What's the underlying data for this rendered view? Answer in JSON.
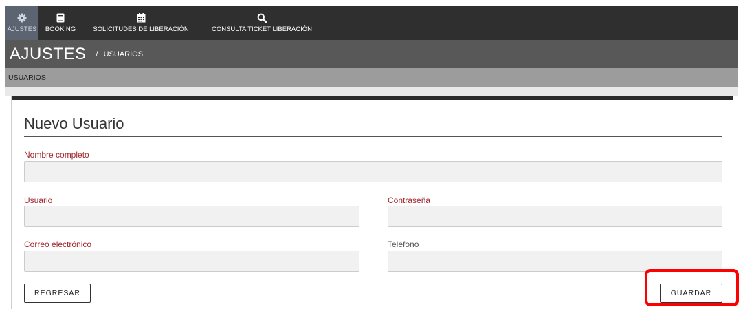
{
  "nav": {
    "items": [
      {
        "label": "AJUSTES",
        "icon": "gear-icon",
        "active": true
      },
      {
        "label": "BOOKING",
        "icon": "book-icon",
        "active": false
      },
      {
        "label": "SOLICITUDES DE LIBERACIÓN",
        "icon": "calendar-icon",
        "active": false
      },
      {
        "label": "CONSULTA TICKET LIBERACIÓN",
        "icon": "search-icon",
        "active": false
      }
    ]
  },
  "header": {
    "title": "AJUSTES",
    "separator": "/",
    "breadcrumb": "USUARIOS"
  },
  "subnav": {
    "link": "USUARIOS"
  },
  "form": {
    "title": "Nuevo Usuario",
    "fields": {
      "nombre": {
        "label": "Nombre completo",
        "value": "",
        "required": true
      },
      "usuario": {
        "label": "Usuario",
        "value": "",
        "required": true
      },
      "contrasena": {
        "label": "Contraseña",
        "value": "",
        "required": true
      },
      "correo": {
        "label": "Correo electrónico",
        "value": "",
        "required": true
      },
      "telefono": {
        "label": "Teléfono",
        "value": "",
        "required": false
      }
    },
    "back_label": "REGRESAR",
    "save_label": "GUARDAR"
  },
  "colors": {
    "nav_bg": "#2f2f2f",
    "active_nav_bg": "#5b6470",
    "title_bar_bg": "#585858",
    "subnav_bg": "#9c9c9c",
    "required_label": "#a2272d",
    "highlight": "#ff0000"
  }
}
